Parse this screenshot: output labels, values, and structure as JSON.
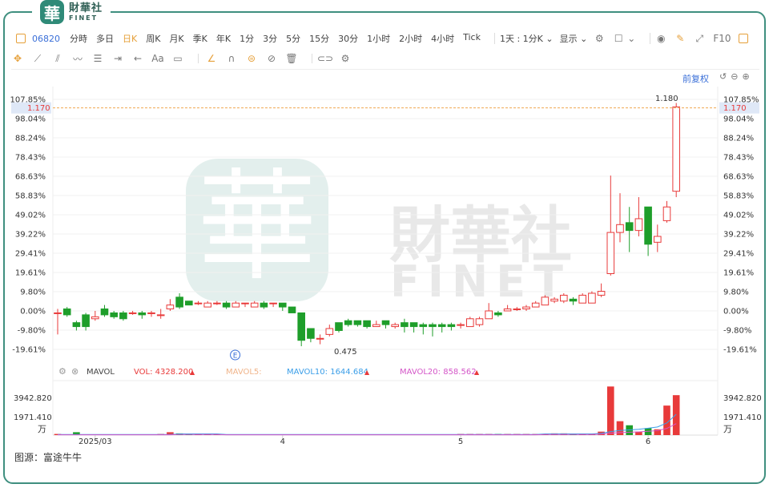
{
  "brand": {
    "name_cn": "財華社",
    "name_en": "FINET",
    "logo_char": "華"
  },
  "toolbar": {
    "code": "06820",
    "periods": [
      "分時",
      "多日",
      "日K",
      "周K",
      "月K",
      "季K",
      "年K",
      "1分",
      "3分",
      "5分",
      "15分",
      "30分",
      "1小时",
      "2小时",
      "4小时",
      "Tick"
    ],
    "active_period": "日K",
    "interval_select": "1天 : 1分K",
    "display_label": "显示",
    "fullscreen_label": "F10"
  },
  "drawing_toolbar": {
    "icons": [
      "crosshair-icon",
      "line-tool-icon",
      "channel-tool-icon",
      "wave-tool-icon",
      "fib-tool-icon",
      "range-tool-icon",
      "arrow-tool-icon",
      "text-tool-icon",
      "note-tool-icon",
      "pen-icon",
      "magnet-icon",
      "lock-drawing-icon",
      "hide-drawing-icon",
      "delete-drawing-icon",
      "link-icon",
      "drawing-settings-icon"
    ],
    "text_tool_label": "Aa"
  },
  "adjust_label": "前复权",
  "source_text": "图源：富途牛牛",
  "watermark": {
    "cn": "財華社",
    "en": "FINET"
  },
  "volume_panel": {
    "label": "MAVOL",
    "vol": "VOL: 4328.200",
    "mavol5": "MAVOL5:",
    "mavol10": "MAVOL10: 1644.684",
    "mavol20": "MAVOL20: 858.562",
    "ticks": [
      "3942.820",
      "1971.410"
    ],
    "unit": "万"
  },
  "colors": {
    "up": "#e83a3a",
    "down": "#1e9e2a",
    "accent": "#e6a03a",
    "link": "#3a6fd8"
  },
  "chart_data": {
    "type": "candlestick",
    "y_axis_ticks": [
      "107.85%",
      "98.04%",
      "88.24%",
      "78.43%",
      "68.63%",
      "58.83%",
      "49.02%",
      "39.22%",
      "29.41%",
      "19.61%",
      "9.80%",
      "0.00%",
      "-9.80%",
      "-19.61%"
    ],
    "y_tick_values": [
      107.85,
      98.04,
      88.24,
      78.43,
      68.63,
      58.83,
      49.02,
      39.22,
      29.41,
      19.61,
      9.8,
      0.0,
      -9.8,
      -19.61
    ],
    "ylim": [
      -19.61,
      107.85
    ],
    "current_price": "1.170",
    "current_pct": 103.5,
    "high_label": "1.180",
    "low_label": "0.475",
    "x_labels": [
      {
        "i": 4,
        "label": "2025/03"
      },
      {
        "i": 24,
        "label": "4"
      },
      {
        "i": 43,
        "label": "5"
      },
      {
        "i": 63,
        "label": "6"
      }
    ],
    "event_marker": {
      "i": 18,
      "label": "E"
    },
    "candles": [
      {
        "o": -1,
        "c": -1,
        "h": 1,
        "l": -12
      },
      {
        "o": 1,
        "c": -2,
        "h": 2,
        "l": -3
      },
      {
        "o": -6,
        "c": -8,
        "h": -5,
        "l": -10
      },
      {
        "o": -2,
        "c": -8,
        "h": -1,
        "l": -10
      },
      {
        "o": -4,
        "c": -3,
        "h": 0,
        "l": -5
      },
      {
        "o": 1,
        "c": -2,
        "h": 3,
        "l": -3
      },
      {
        "o": -1,
        "c": -3,
        "h": 0,
        "l": -4
      },
      {
        "o": -1,
        "c": -4,
        "h": 0,
        "l": -5
      },
      {
        "o": -1,
        "c": -1,
        "h": 0,
        "l": -2
      },
      {
        "o": -1,
        "c": -2,
        "h": 0,
        "l": -4
      },
      {
        "o": -1,
        "c": -1,
        "h": 0,
        "l": -3
      },
      {
        "o": -2,
        "c": -2,
        "h": 1,
        "l": -4
      },
      {
        "o": 1,
        "c": 3,
        "h": 6,
        "l": 0
      },
      {
        "o": 7,
        "c": 2,
        "h": 9,
        "l": 1
      },
      {
        "o": 5,
        "c": 3,
        "h": 5,
        "l": 3
      },
      {
        "o": 4,
        "c": 4,
        "h": 5,
        "l": 3
      },
      {
        "o": 2,
        "c": 4,
        "h": 5,
        "l": 2
      },
      {
        "o": 4,
        "c": 4,
        "h": 5,
        "l": 3
      },
      {
        "o": 4,
        "c": 2,
        "h": 5,
        "l": 1
      },
      {
        "o": 2,
        "c": 4,
        "h": 5,
        "l": 2
      },
      {
        "o": 4,
        "c": 4,
        "h": 4,
        "l": 2
      },
      {
        "o": 2,
        "c": 4,
        "h": 5,
        "l": 2
      },
      {
        "o": 4,
        "c": 2,
        "h": 5,
        "l": 1
      },
      {
        "o": 4,
        "c": 4,
        "h": 4,
        "l": 2
      },
      {
        "o": 4,
        "c": 2,
        "h": 4,
        "l": 0
      },
      {
        "o": 2,
        "c": -1,
        "h": 2,
        "l": -1
      },
      {
        "o": -1,
        "c": -15,
        "h": -1,
        "l": -18
      },
      {
        "o": -9,
        "c": -14,
        "h": -9,
        "l": -16
      },
      {
        "o": -14,
        "c": -14,
        "h": -12,
        "l": -17
      },
      {
        "o": -12,
        "c": -9,
        "h": -7,
        "l": -13
      },
      {
        "o": -6,
        "c": -10,
        "h": -6,
        "l": -11
      },
      {
        "o": -5,
        "c": -7,
        "h": -4,
        "l": -8
      },
      {
        "o": -5,
        "c": -7,
        "h": -5,
        "l": -8
      },
      {
        "o": -5,
        "c": -8,
        "h": -5,
        "l": -9
      },
      {
        "o": -8,
        "c": -7,
        "h": -5,
        "l": -8
      },
      {
        "o": -5,
        "c": -7,
        "h": -5,
        "l": -9
      },
      {
        "o": -8,
        "c": -7,
        "h": -6,
        "l": -9
      },
      {
        "o": -6,
        "c": -8,
        "h": -4,
        "l": -11
      },
      {
        "o": -6,
        "c": -8,
        "h": -6,
        "l": -11
      },
      {
        "o": -7,
        "c": -8,
        "h": -6,
        "l": -12
      },
      {
        "o": -7,
        "c": -8,
        "h": -6,
        "l": -13
      },
      {
        "o": -7,
        "c": -8,
        "h": -6,
        "l": -11
      },
      {
        "o": -7,
        "c": -8,
        "h": -6,
        "l": -10
      },
      {
        "o": -7,
        "c": -7,
        "h": -6,
        "l": -9
      },
      {
        "o": -8,
        "c": -4,
        "h": -3,
        "l": -8
      },
      {
        "o": -7,
        "c": -4,
        "h": -3,
        "l": -8
      },
      {
        "o": -4,
        "c": 0,
        "h": 4,
        "l": -4
      },
      {
        "o": -1,
        "c": -2,
        "h": 0,
        "l": -3
      },
      {
        "o": 0,
        "c": 1,
        "h": 3,
        "l": 0
      },
      {
        "o": 1,
        "c": 1,
        "h": 2,
        "l": 0
      },
      {
        "o": 1,
        "c": 2,
        "h": 3,
        "l": 0
      },
      {
        "o": 2,
        "c": 4,
        "h": 5,
        "l": 2
      },
      {
        "o": 3,
        "c": 7,
        "h": 8,
        "l": 3
      },
      {
        "o": 5,
        "c": 6,
        "h": 7,
        "l": 4
      },
      {
        "o": 5,
        "c": 8,
        "h": 9,
        "l": 4
      },
      {
        "o": 6,
        "c": 5,
        "h": 7,
        "l": 3
      },
      {
        "o": 4,
        "c": 8,
        "h": 9,
        "l": 4
      },
      {
        "o": 4,
        "c": 9,
        "h": 10,
        "l": 4
      },
      {
        "o": 8,
        "c": 10,
        "h": 14,
        "l": 7
      },
      {
        "o": 19,
        "c": 40,
        "h": 69,
        "l": 18
      },
      {
        "o": 40,
        "c": 44,
        "h": 60,
        "l": 35
      },
      {
        "o": 45,
        "c": 41,
        "h": 53,
        "l": 30
      },
      {
        "o": 41,
        "c": 47,
        "h": 58,
        "l": 38
      },
      {
        "o": 53,
        "c": 34,
        "h": 53,
        "l": 28
      },
      {
        "o": 35,
        "c": 38,
        "h": 44,
        "l": 30
      },
      {
        "o": 46,
        "c": 53,
        "h": 56,
        "l": 45
      },
      {
        "o": 61,
        "c": 104,
        "h": 106,
        "l": 58
      }
    ],
    "volumes": [
      0.02,
      0.01,
      0.05,
      0.01,
      0.01,
      0.01,
      0.01,
      0.01,
      0.01,
      0.01,
      0.01,
      0.02,
      0.05,
      0.03,
      0.02,
      0.01,
      0.01,
      0.01,
      0.01,
      0.01,
      0.01,
      0.01,
      0.01,
      0.01,
      0.01,
      0.01,
      0.01,
      0.01,
      0.01,
      0.01,
      0.01,
      0.01,
      0.01,
      0.01,
      0.01,
      0.01,
      0.01,
      0.01,
      0.01,
      0.01,
      0.01,
      0.01,
      0.01,
      0.02,
      0.02,
      0.02,
      0.02,
      0.02,
      0.02,
      0.02,
      0.02,
      0.02,
      0.02,
      0.03,
      0.03,
      0.02,
      0.02,
      0.02,
      0.06,
      0.84,
      0.24,
      0.17,
      0.06,
      0.12,
      0.1,
      0.51,
      0.69
    ],
    "ma_line": [
      0.01,
      0.01,
      0.01,
      0.01,
      0.01,
      0.01,
      0.01,
      0.01,
      0.01,
      0.01,
      0.01,
      0.01,
      0.01,
      0.02,
      0.02,
      0.02,
      0.02,
      0.02,
      0.01,
      0.01,
      0.01,
      0.01,
      0.01,
      0.01,
      0.01,
      0.01,
      0.01,
      0.01,
      0.01,
      0.01,
      0.01,
      0.01,
      0.01,
      0.01,
      0.01,
      0.01,
      0.01,
      0.01,
      0.01,
      0.01,
      0.01,
      0.01,
      0.01,
      0.01,
      0.01,
      0.01,
      0.01,
      0.01,
      0.01,
      0.01,
      0.01,
      0.01,
      0.02,
      0.02,
      0.02,
      0.02,
      0.02,
      0.02,
      0.03,
      0.06,
      0.08,
      0.09,
      0.1,
      0.12,
      0.14,
      0.21,
      0.36
    ]
  }
}
